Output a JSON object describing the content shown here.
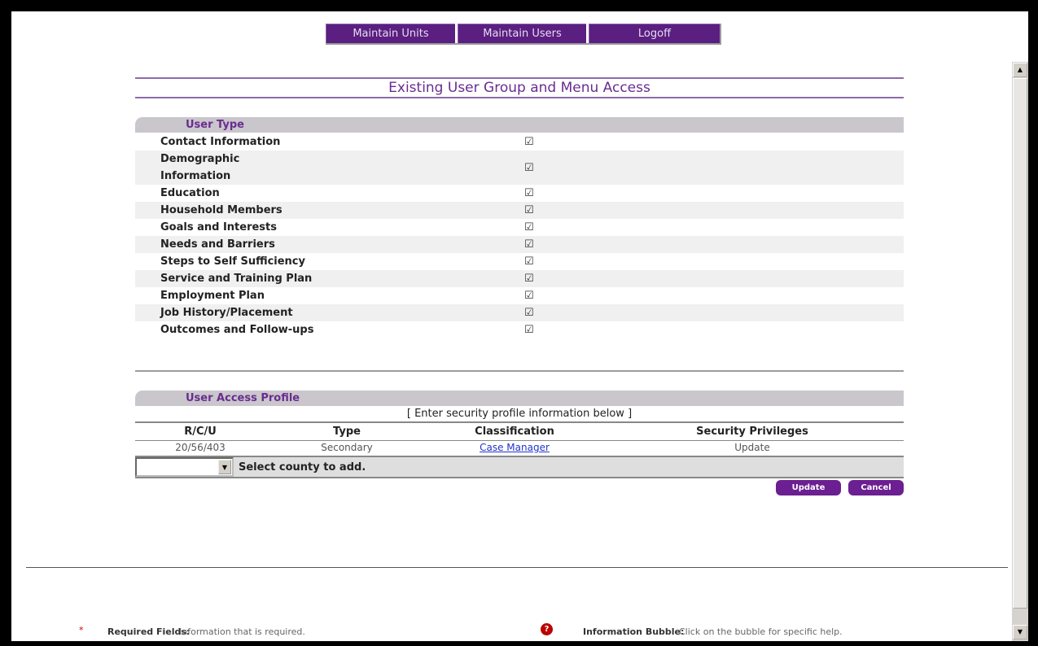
{
  "nav": {
    "maintain_units": "Maintain Units",
    "maintain_users": "Maintain Users",
    "logoff": "Logoff"
  },
  "page_title": "Existing User Group and Menu Access",
  "user_type": {
    "header": "User Type",
    "items": [
      {
        "label": "Contact Information",
        "checked": true
      },
      {
        "label": "Demographic Information",
        "checked": true
      },
      {
        "label": "Education",
        "checked": true
      },
      {
        "label": "Household Members",
        "checked": true
      },
      {
        "label": "Goals and Interests",
        "checked": true
      },
      {
        "label": "Needs and Barriers",
        "checked": true
      },
      {
        "label": "Steps to Self Sufficiency",
        "checked": true
      },
      {
        "label": "Service and Training Plan",
        "checked": true
      },
      {
        "label": "Employment Plan",
        "checked": true
      },
      {
        "label": "Job History/Placement",
        "checked": true
      },
      {
        "label": "Outcomes and Follow-ups",
        "checked": true
      }
    ]
  },
  "access_profile": {
    "header": "User Access Profile",
    "instruction": "[ Enter security profile information below ]",
    "columns": [
      "R/C/U",
      "Type",
      "Classification",
      "Security Privileges"
    ],
    "rows": [
      {
        "rcu": "20/56/403",
        "type": "Secondary",
        "classification": "Case Manager",
        "privileges": "Update"
      }
    ],
    "county_select_value": "",
    "county_label": "Select county to add."
  },
  "buttons": {
    "update": "Update",
    "cancel": "Cancel"
  },
  "footer": {
    "required_star": "*",
    "required_label": "Required Fields:",
    "required_desc": "Information that is required.",
    "bubble_icon": "?",
    "bubble_label": "Information Bubble:",
    "bubble_desc": "Click on the bubble for specific help."
  },
  "colors": {
    "accent_purple": "#5a1f80",
    "title_purple": "#6a2c90",
    "section_gray": "#c9c6cc",
    "link_blue": "#2233cc"
  },
  "icons": {
    "checkbox": "checkbox-checked-icon",
    "dropdown": "chevron-down-icon",
    "help": "question-bubble-icon"
  }
}
